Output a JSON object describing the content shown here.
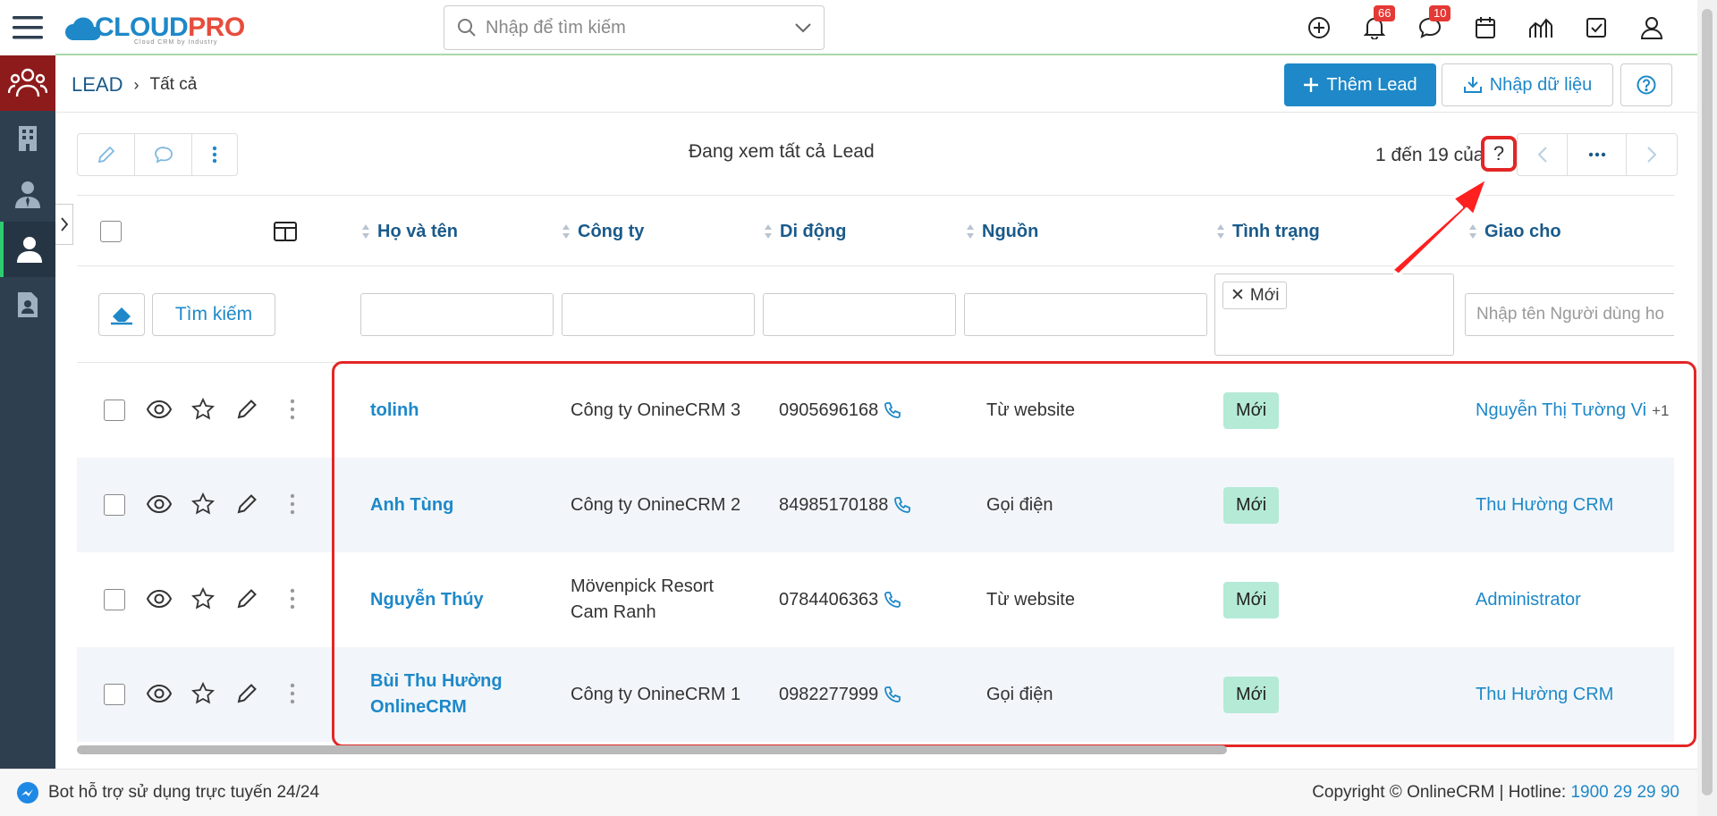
{
  "app": {
    "logo_main": "CLOUD",
    "logo_accent": "PRO",
    "logo_tagline": "Cloud CRM by Industry"
  },
  "search": {
    "placeholder": "Nhập để tìm kiếm"
  },
  "topbar": {
    "notifications_count": "66",
    "messages_count": "10",
    "icons": [
      "add-circle-icon",
      "bell-icon",
      "chat-icon",
      "calendar-icon",
      "chart-icon",
      "task-icon",
      "user-icon"
    ]
  },
  "sidebar": {
    "items": [
      "contacts-group-icon",
      "building-icon",
      "person-tie-icon",
      "person-icon",
      "document-icon"
    ]
  },
  "breadcrumb": {
    "module": "LEAD",
    "view": "Tất cả"
  },
  "toolbar": {
    "add_label": "Thêm Lead",
    "import_label": "Nhập dữ liệu",
    "viewing_prefix": "Đang xem tất cả",
    "viewing_module": "Lead",
    "pager_text": "1 đến 19 của",
    "pager_unknown": "?"
  },
  "table": {
    "columns": [
      "Họ và tên",
      "Công ty",
      "Di động",
      "Nguồn",
      "Tình trạng",
      "Giao cho"
    ],
    "filters": {
      "search_label": "Tìm kiếm",
      "status_tag": "Mới",
      "assignee_placeholder": "Nhập tên Người dùng hoặc Nhóm"
    },
    "rows": [
      {
        "name": "tolinh",
        "company": "Công ty OnineCRM 3",
        "phone": "0905696168",
        "source": "Từ website",
        "status": "Mới",
        "assignee": "Nguyễn Thị Tường Vi",
        "extra": "+1"
      },
      {
        "name": "Anh Tùng",
        "company": "Công ty OnineCRM 2",
        "phone": "84985170188",
        "source": "Gọi điện",
        "status": "Mới",
        "assignee": "Thu Hường CRM",
        "extra": ""
      },
      {
        "name": "Nguyễn Thúy",
        "company": "Mövenpick Resort Cam Ranh",
        "phone": "0784406363",
        "source": "Từ website",
        "status": "Mới",
        "assignee": "Administrator",
        "extra": ""
      },
      {
        "name": "Bùi Thu Hường OnlineCRM",
        "company": "Công ty OnineCRM 1",
        "phone": "0982277999",
        "source": "Gọi điện",
        "status": "Mới",
        "assignee": "Thu Hường CRM",
        "extra": ""
      }
    ]
  },
  "footer": {
    "bot_text": "Bot hỗ trợ sử dụng trực tuyến 24/24",
    "copyright": "Copyright © OnlineCRM",
    "hotline_label": "Hotline:",
    "hotline": "1900 29 29 90"
  },
  "colors": {
    "accent": "#1e88c8",
    "sidebar": "#2e3f50",
    "highlight": "#e32626",
    "status": "#b5ead7"
  }
}
